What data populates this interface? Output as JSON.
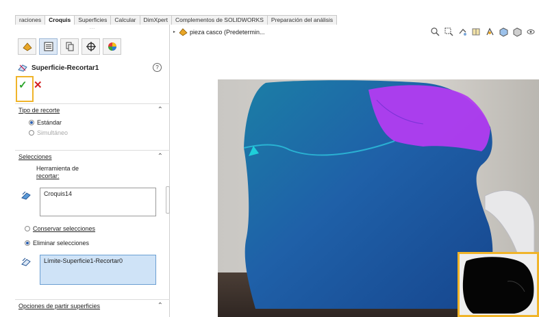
{
  "tabs": [
    "raciones",
    "Croquis",
    "Superficies",
    "Calcular",
    "DimXpert",
    "Complementos de SOLIDWORKS",
    "Preparación del análisis"
  ],
  "active_tab_index": 1,
  "panel": {
    "grip": "⋯",
    "feature_title": "Superficie-Recortar1",
    "help_glyph": "?",
    "ok_glyph": "✓",
    "cancel_glyph": "✕",
    "sections": {
      "trim_type": {
        "label": "Tipo de recorte",
        "chevron": "⌃",
        "options": [
          {
            "label": "Estándar",
            "selected": true,
            "enabled": true
          },
          {
            "label": "Simultáneo",
            "selected": false,
            "enabled": false
          }
        ]
      },
      "selections": {
        "label": "Selecciones",
        "chevron": "⌃",
        "tool_label_line1": "Herramienta de",
        "tool_label_line2": "recortar:",
        "tool_value": "Croquis14",
        "keep_option": "Conservar selecciones",
        "remove_option": "Eliminar selecciones",
        "remove_selected": true,
        "pieces_value": "Límite-Superficie1-Recortar0"
      },
      "split_options": {
        "label": "Opciones de partir superficies",
        "chevron": "⌃"
      }
    }
  },
  "viewport": {
    "document_title": "pieza casco  (Predetermin...",
    "expand_glyph": "▸"
  },
  "colors": {
    "highlight": "#f0b429",
    "surface_blue": "#1f5fa8",
    "surface_magenta": "#b23cf0",
    "ok_green": "#2aa52a",
    "cancel_red": "#d21f1f"
  }
}
